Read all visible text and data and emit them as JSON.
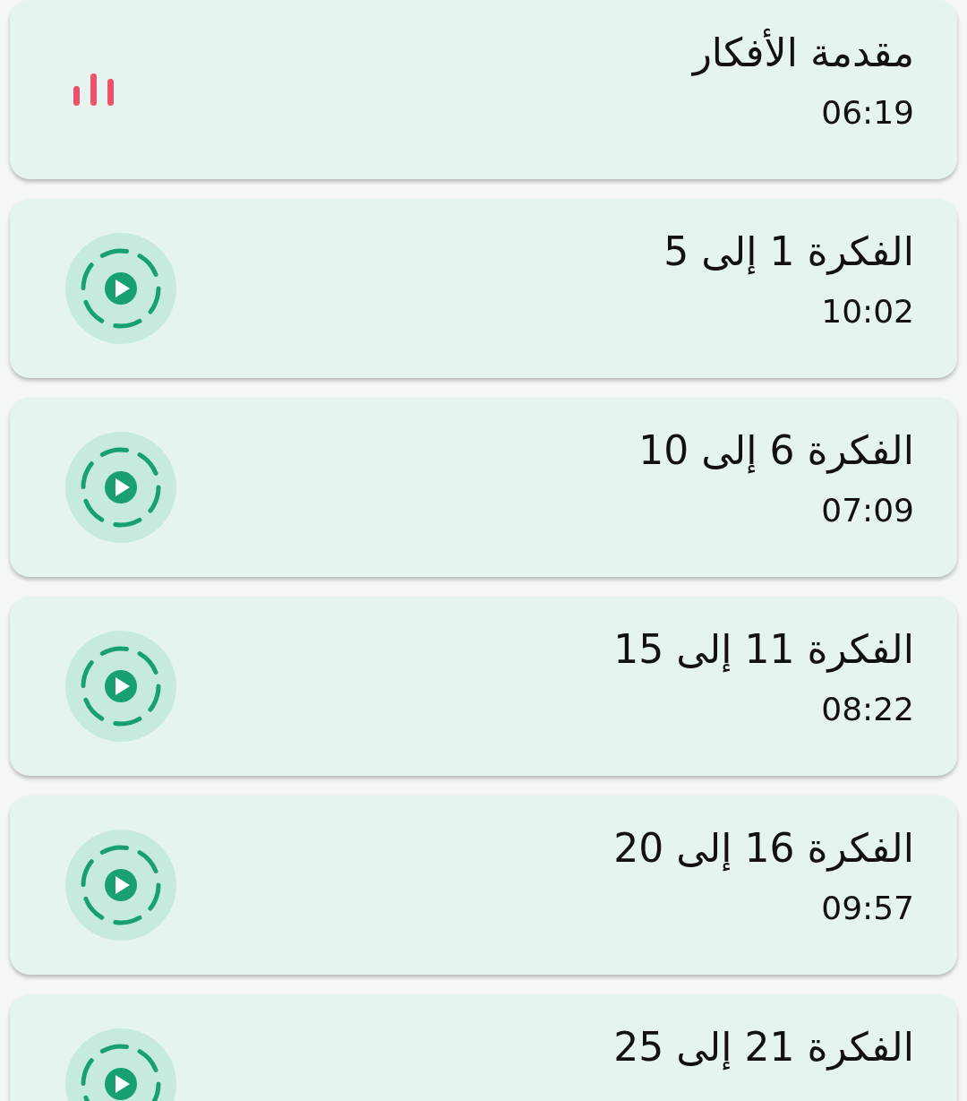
{
  "tracks": [
    {
      "title": "مقدمة الأفكار",
      "duration": "06:19",
      "playing": true
    },
    {
      "title": "الفكرة 1 إلى 5",
      "duration": "10:02",
      "playing": false
    },
    {
      "title": "الفكرة 6 إلى 10",
      "duration": "07:09",
      "playing": false
    },
    {
      "title": "الفكرة 11 إلى 15",
      "duration": "08:22",
      "playing": false
    },
    {
      "title": "الفكرة 16 إلى 20",
      "duration": "09:57",
      "playing": false
    },
    {
      "title": "الفكرة 21 إلى 25",
      "playing": false
    }
  ]
}
